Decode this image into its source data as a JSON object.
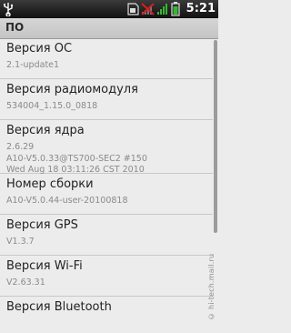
{
  "status_bar": {
    "time": "5:21",
    "icons": [
      "usb-icon",
      "sim-icon",
      "no-signal-icon",
      "signal-icon",
      "battery-icon"
    ]
  },
  "header": {
    "title": "ПО"
  },
  "items": [
    {
      "title": "Версия ОС",
      "value": "2.1-update1"
    },
    {
      "title": "Версия радиомодуля",
      "value": "534004_1.15.0_0818"
    },
    {
      "title": "Версия ядра",
      "value": "2.6.29\nA10-V5.0.33@TS700-SEC2 #150\nWed Aug 18 03:11:26 CST 2010"
    },
    {
      "title": "Номер сборки",
      "value": "A10-V5.0.44-user-20100818"
    },
    {
      "title": "Версия GPS",
      "value": "V1.3.7"
    },
    {
      "title": "Версия Wi-Fi",
      "value": "V2.63.31"
    },
    {
      "title": "Версия Bluetooth",
      "value": ""
    }
  ],
  "watermark": "© hi-tech.mail.ru",
  "colors": {
    "accent_red": "#d42020",
    "signal_green": "#35b82f"
  }
}
